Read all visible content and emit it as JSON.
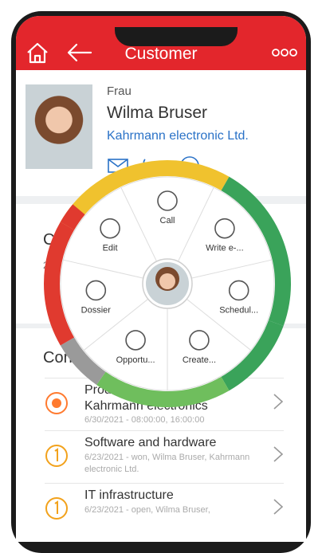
{
  "header": {
    "title": "Customer"
  },
  "contact": {
    "salutation": "Frau",
    "name": "Wilma Bruser",
    "company": "Kahrmann electronic Ltd."
  },
  "section1": {
    "label_visible": "Co",
    "sub_visible": "2"
  },
  "list": {
    "label_visible": "Con",
    "rows": [
      {
        "title_visible": "Produ",
        "subtitle": "Kahrmann electronics",
        "meta": "6/30/2021 - 08:00:00, 16:00:00",
        "status_color": "#ff7a2f"
      },
      {
        "title": "Software and hardware",
        "meta": "6/23/2021 - won, Wilma Bruser, Kahrmann electronic Ltd.",
        "status_color": "#f2a21c"
      },
      {
        "title": "IT infrastructure",
        "meta": "6/23/2021 - open, Wilma Bruser,",
        "status_color": "#f2a21c"
      }
    ]
  },
  "wheel": {
    "items": [
      {
        "label": "Call"
      },
      {
        "label": "Write e-..."
      },
      {
        "label": "Schedul..."
      },
      {
        "label": "Create..."
      },
      {
        "label": "Opportu..."
      },
      {
        "label": "Dossier"
      },
      {
        "label": "Edit"
      }
    ],
    "colors": {
      "red": "#e03a2f",
      "yellow": "#f0c22e",
      "green": "#3aa35a",
      "lightgreen": "#6fbe5d",
      "gray": "#9a9a9a"
    }
  }
}
